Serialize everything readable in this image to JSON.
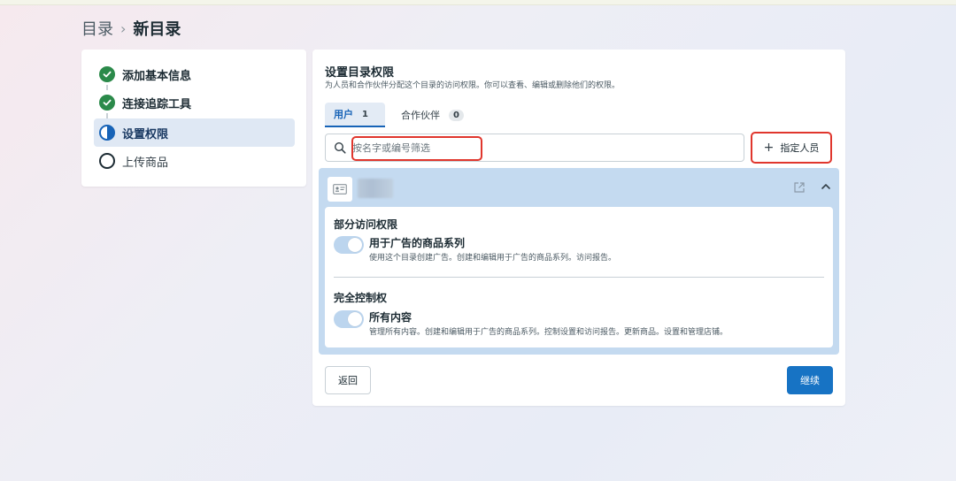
{
  "breadcrumb": {
    "root": "目录",
    "separator": "›",
    "current": "新目录"
  },
  "steps": [
    {
      "label": "添加基本信息",
      "status": "done"
    },
    {
      "label": "连接追踪工具",
      "status": "done"
    },
    {
      "label": "设置权限",
      "status": "in-progress"
    },
    {
      "label": "上传商品",
      "status": "todo"
    }
  ],
  "permissions_section": {
    "title": "设置目录权限",
    "description": "为人员和合作伙伴分配这个目录的访问权限。你可以查看、编辑或删除他们的权限。"
  },
  "tabs": [
    {
      "label": "用户",
      "count": "1",
      "active": true
    },
    {
      "label": "合作伙伴",
      "count": "0",
      "active": false
    }
  ],
  "search": {
    "value": "",
    "placeholder": "按名字或编号筛选"
  },
  "assign_button": {
    "label": "指定人员"
  },
  "person_permissions": {
    "partial_heading": "部分访问权限",
    "partial_items": [
      {
        "name": "用于广告的商品系列",
        "description": "使用这个目录创建广告。创建和编辑用于广告的商品系列。访问报告。",
        "enabled": true
      }
    ],
    "full_heading": "完全控制权",
    "full_items": [
      {
        "name": "所有内容",
        "description": "管理所有内容。创建和编辑用于广告的商品系列。控制设置和访问报告。更新商品。设置和管理店铺。",
        "enabled": true
      }
    ]
  },
  "footer": {
    "back_label": "返回",
    "continue_label": "继续"
  },
  "colors": {
    "accent": "#1773c4",
    "done_green": "#2b8a4a",
    "highlight_red": "#e0362d",
    "panel_blue": "#c4daf0"
  }
}
